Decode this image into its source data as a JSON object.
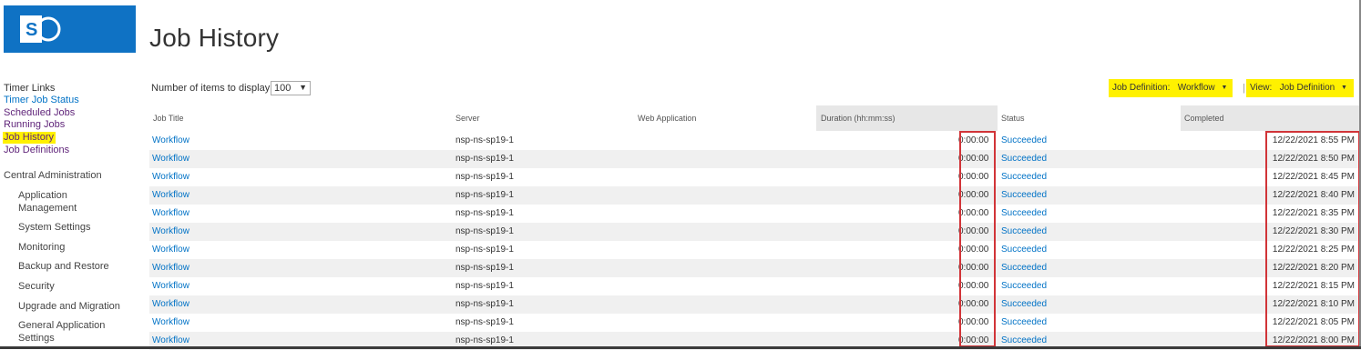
{
  "page": {
    "title": "Job History"
  },
  "nav": {
    "timer_links": "Timer Links",
    "items": [
      {
        "label": "Timer Job Status"
      },
      {
        "label": "Scheduled Jobs"
      },
      {
        "label": "Running Jobs"
      },
      {
        "label": "Job History"
      },
      {
        "label": "Job Definitions"
      }
    ],
    "central_admin": "Central Administration",
    "ca_items": [
      {
        "label": "Application Management"
      },
      {
        "label": "System Settings"
      },
      {
        "label": "Monitoring"
      },
      {
        "label": "Backup and Restore"
      },
      {
        "label": "Security"
      },
      {
        "label": "Upgrade and Migration"
      },
      {
        "label": "General Application Settings"
      }
    ]
  },
  "toolbar": {
    "items_label": "Number of items to display:",
    "items_value": "100",
    "job_def_label": "Job Definition:",
    "job_def_value": "Workflow",
    "separator": "|",
    "view_label": "View:",
    "view_value": "Job Definition"
  },
  "table": {
    "headers": {
      "job_title": "Job Title",
      "server": "Server",
      "web_app": "Web Application",
      "duration": "Duration (hh:mm:ss)",
      "status": "Status",
      "completed": "Completed"
    },
    "rows": [
      {
        "title": "Workflow",
        "server": "nsp-ns-sp19-1",
        "duration": "0:00:00",
        "status": "Succeeded",
        "completed": "12/22/2021 8:55 PM"
      },
      {
        "title": "Workflow",
        "server": "nsp-ns-sp19-1",
        "duration": "0:00:00",
        "status": "Succeeded",
        "completed": "12/22/2021 8:50 PM"
      },
      {
        "title": "Workflow",
        "server": "nsp-ns-sp19-1",
        "duration": "0:00:00",
        "status": "Succeeded",
        "completed": "12/22/2021 8:45 PM"
      },
      {
        "title": "Workflow",
        "server": "nsp-ns-sp19-1",
        "duration": "0:00:00",
        "status": "Succeeded",
        "completed": "12/22/2021 8:40 PM"
      },
      {
        "title": "Workflow",
        "server": "nsp-ns-sp19-1",
        "duration": "0:00:00",
        "status": "Succeeded",
        "completed": "12/22/2021 8:35 PM"
      },
      {
        "title": "Workflow",
        "server": "nsp-ns-sp19-1",
        "duration": "0:00:00",
        "status": "Succeeded",
        "completed": "12/22/2021 8:30 PM"
      },
      {
        "title": "Workflow",
        "server": "nsp-ns-sp19-1",
        "duration": "0:00:00",
        "status": "Succeeded",
        "completed": "12/22/2021 8:25 PM"
      },
      {
        "title": "Workflow",
        "server": "nsp-ns-sp19-1",
        "duration": "0:00:00",
        "status": "Succeeded",
        "completed": "12/22/2021 8:20 PM"
      },
      {
        "title": "Workflow",
        "server": "nsp-ns-sp19-1",
        "duration": "0:00:00",
        "status": "Succeeded",
        "completed": "12/22/2021 8:15 PM"
      },
      {
        "title": "Workflow",
        "server": "nsp-ns-sp19-1",
        "duration": "0:00:00",
        "status": "Succeeded",
        "completed": "12/22/2021 8:10 PM"
      },
      {
        "title": "Workflow",
        "server": "nsp-ns-sp19-1",
        "duration": "0:00:00",
        "status": "Succeeded",
        "completed": "12/22/2021 8:05 PM"
      },
      {
        "title": "Workflow",
        "server": "nsp-ns-sp19-1",
        "duration": "0:00:00",
        "status": "Succeeded",
        "completed": "12/22/2021 8:00 PM"
      }
    ]
  },
  "icons": {
    "logo": "sharepoint-logo-icon",
    "dropdown": "chevron-down-icon"
  },
  "colors": {
    "brand": "#0f72c4",
    "link": "#0072c6",
    "highlight": "#fff100",
    "annotation": "#d13438"
  }
}
